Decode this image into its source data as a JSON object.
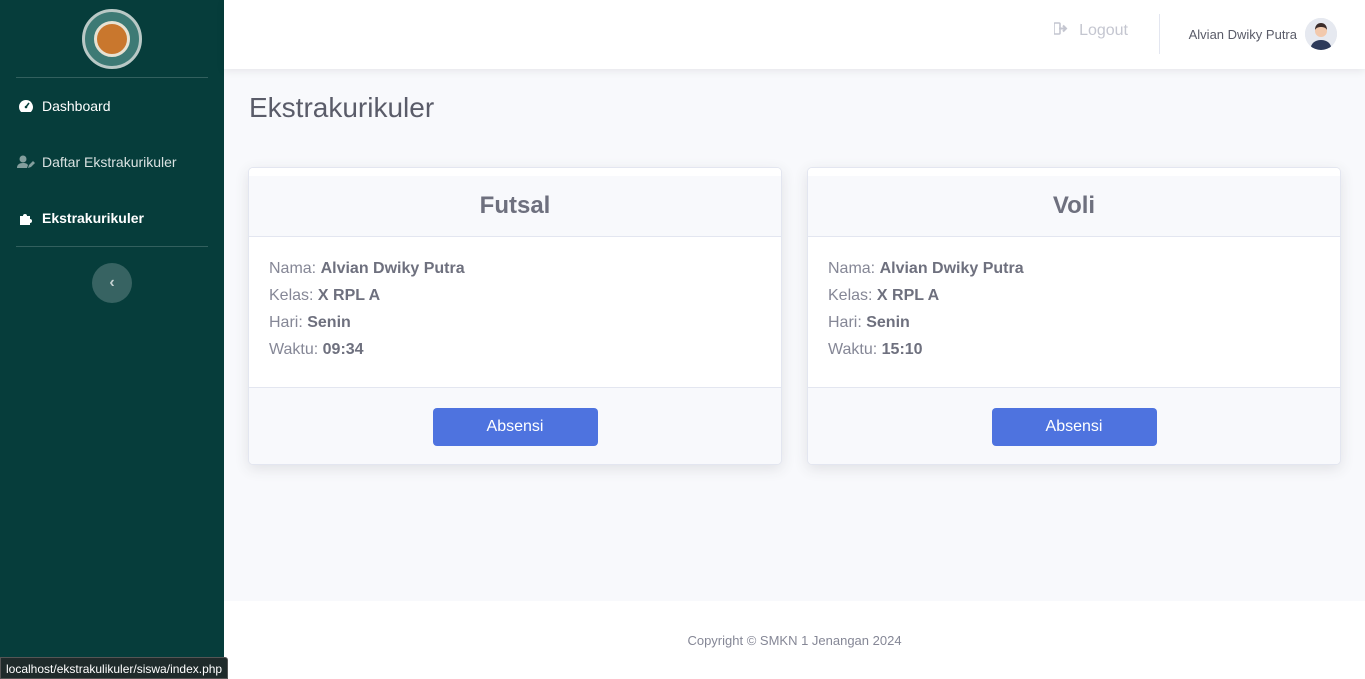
{
  "sidebar": {
    "items": [
      {
        "label": "Dashboard",
        "icon": "tachometer-icon"
      },
      {
        "label": "Daftar Ekstrakurikuler",
        "icon": "user-edit-icon"
      },
      {
        "label": "Ekstrakurikuler",
        "icon": "puzzle-icon"
      }
    ],
    "toggle_icon": "chevron-left-icon"
  },
  "topbar": {
    "logout_label": "Logout",
    "user_name": "Alvian Dwiky Putra"
  },
  "page": {
    "title": "Ekstrakurikuler"
  },
  "cards": [
    {
      "title": "Futsal",
      "nama_label": "Nama:",
      "nama": "Alvian Dwiky Putra",
      "kelas_label": "Kelas:",
      "kelas": "X RPL A",
      "hari_label": "Hari:",
      "hari": "Senin",
      "waktu_label": "Waktu:",
      "waktu": "09:34",
      "button": "Absensi"
    },
    {
      "title": "Voli",
      "nama_label": "Nama:",
      "nama": "Alvian Dwiky Putra",
      "kelas_label": "Kelas:",
      "kelas": "X RPL A",
      "hari_label": "Hari:",
      "hari": "Senin",
      "waktu_label": "Waktu:",
      "waktu": "15:10",
      "button": "Absensi"
    }
  ],
  "footer": {
    "copyright": "Copyright © SMKN 1 Jenangan 2024"
  },
  "status_bar": {
    "url": "localhost/ekstrakulikuler/siswa/index.php"
  },
  "colors": {
    "sidebar_bg": "#063d3b",
    "primary": "#4e73df",
    "page_bg": "#f8f9fc"
  }
}
